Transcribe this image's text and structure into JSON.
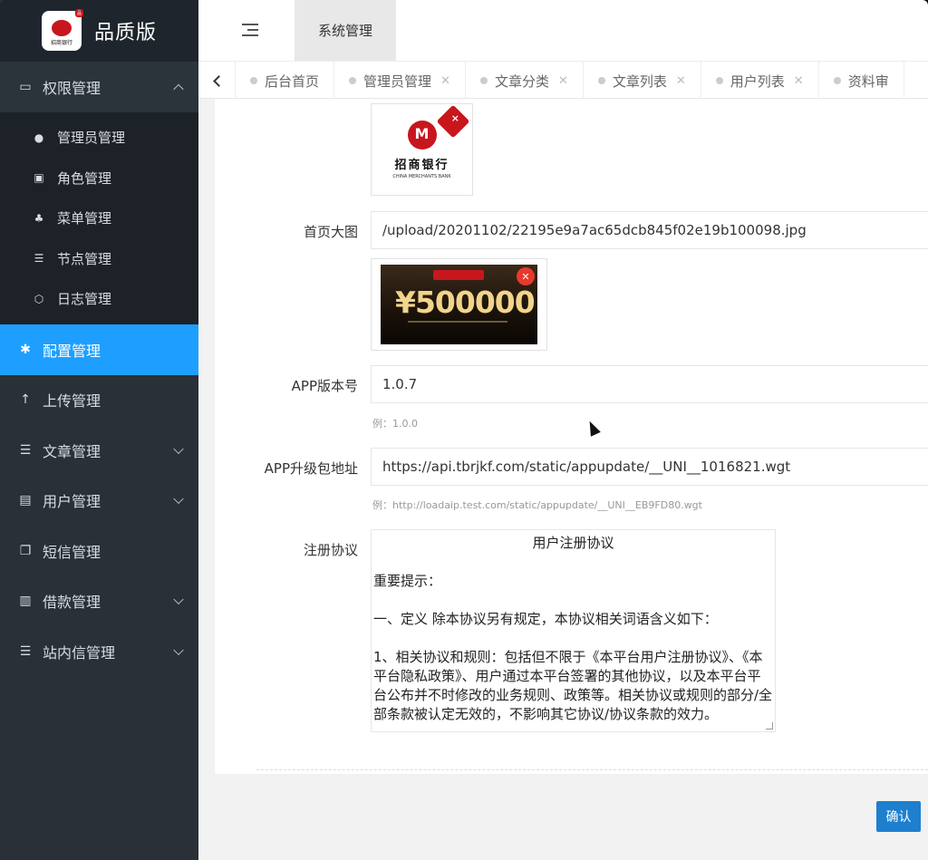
{
  "app": {
    "logo_text": "品质版",
    "logo_caption": "招商银行"
  },
  "sidebar": {
    "groups": [
      {
        "label": "权限管理",
        "icon": "laptop-icon",
        "open": true,
        "children": [
          {
            "label": "管理员管理",
            "icon": "user-icon"
          },
          {
            "label": "角色管理",
            "icon": "role-icon"
          },
          {
            "label": "菜单管理",
            "icon": "tree-icon"
          },
          {
            "label": "节点管理",
            "icon": "list-icon"
          },
          {
            "label": "日志管理",
            "icon": "log-icon"
          }
        ]
      },
      {
        "label": "配置管理",
        "icon": "asterisk-icon",
        "active": true
      },
      {
        "label": "上传管理",
        "icon": "upload-arrow-icon"
      },
      {
        "label": "文章管理",
        "icon": "list-icon",
        "has_arrow": true
      },
      {
        "label": "用户管理",
        "icon": "id-card-icon",
        "has_arrow": true
      },
      {
        "label": "短信管理",
        "icon": "copy-icon"
      },
      {
        "label": "借款管理",
        "icon": "money-icon",
        "has_arrow": true
      },
      {
        "label": "站内信管理",
        "icon": "list-icon",
        "has_arrow": true
      }
    ]
  },
  "topbar": {
    "current": "系统管理"
  },
  "tabs": [
    {
      "label": "后台首页",
      "closable": false
    },
    {
      "label": "管理员管理",
      "closable": true
    },
    {
      "label": "文章分类",
      "closable": true
    },
    {
      "label": "文章列表",
      "closable": true
    },
    {
      "label": "用户列表",
      "closable": true
    },
    {
      "label": "资料审",
      "closable": false
    }
  ],
  "form": {
    "logo_image": {
      "bank_name": "招商银行",
      "bank_en": "CHINA MERCHANTS BANK"
    },
    "home_banner": {
      "label": "首页大图",
      "value": "/upload/20201102/22195e9a7ac65dcb845f02e19b100098.jpg",
      "amount": "¥500000"
    },
    "app_version": {
      "label": "APP版本号",
      "value": "1.0.7",
      "hint": "例：1.0.0"
    },
    "app_upgrade": {
      "label": "APP升级包地址",
      "value": "https://api.tbrjkf.com/static/appupdate/__UNI__1016821.wgt",
      "hint": "例：http://loadaip.test.com/static/appupdate/__UNI__EB9FD80.wgt"
    },
    "agreement": {
      "label": "注册协议",
      "title": "用户注册协议",
      "p1": "重要提示：",
      "p2": " 一、定义 除本协议另有规定，本协议相关词语含义如下：",
      "p3": " 1、相关协议和规则：包括但不限于《本平台用户注册协议》、《本平台隐私政策》、用户通过本平台签署的其他协议，以及本平台平台公布并不时修改的业务规则、政策等。相关协议或规则的部分/全部条款被认定无效的，不影响其它协议/协议条款的效力。"
    },
    "confirm_label": "确认"
  }
}
